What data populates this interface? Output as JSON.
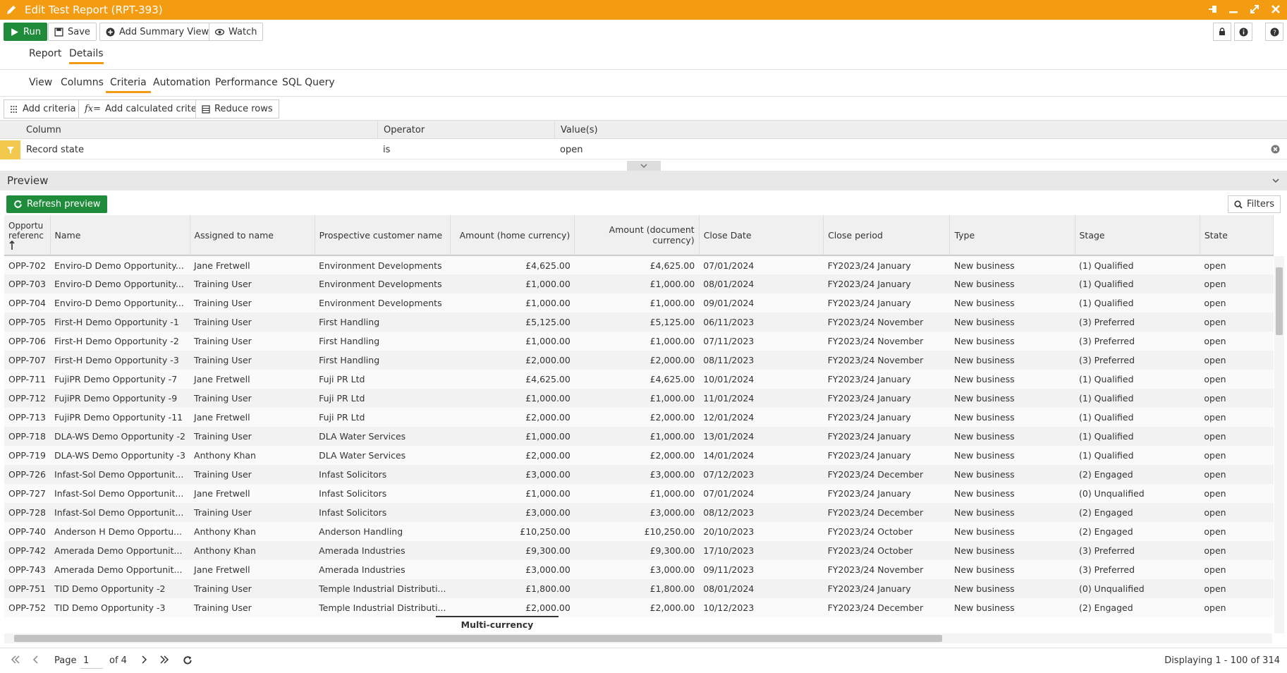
{
  "window": {
    "title": "Edit Test Report (RPT-393)",
    "accent": "#f39c12"
  },
  "toolbar": {
    "run_label": "Run",
    "save_label": "Save",
    "add_summary_label": "Add Summary View",
    "watch_label": "Watch"
  },
  "tabs_main": [
    "Report",
    "Details"
  ],
  "tabs_sub": [
    "View",
    "Columns",
    "Criteria",
    "Automation",
    "Performance",
    "SQL Query"
  ],
  "criteria_toolbar": {
    "add_criteria": "Add criteria",
    "add_calculated": "Add calculated criteria",
    "reduce_rows": "Reduce rows"
  },
  "criteria": {
    "headers": [
      "Column",
      "Operator",
      "Value(s)"
    ],
    "rows": [
      {
        "column": "Record state",
        "operator": "is",
        "value": "open"
      }
    ]
  },
  "preview": {
    "title": "Preview",
    "refresh_label": "Refresh preview",
    "filters_label": "Filters"
  },
  "grid": {
    "headers": [
      "Opportu referenc",
      "Name",
      "Assigned to name",
      "Prospective customer name",
      "Amount (home currency)",
      "Amount (document currency)",
      "Close Date",
      "Close period",
      "Type",
      "Stage",
      "State"
    ],
    "rows": [
      [
        "OPP-702",
        "Enviro-D Demo Opportunity...",
        "Jane Fretwell",
        "Environment Developments",
        "£4,625.00",
        "£4,625.00",
        "07/01/2024",
        "FY2023/24 January",
        "New business",
        "(1) Qualified",
        "open"
      ],
      [
        "OPP-703",
        "Enviro-D Demo Opportunity...",
        "Training User",
        "Environment Developments",
        "£1,000.00",
        "£1,000.00",
        "08/01/2024",
        "FY2023/24 January",
        "New business",
        "(1) Qualified",
        "open"
      ],
      [
        "OPP-704",
        "Enviro-D Demo Opportunity...",
        "Training User",
        "Environment Developments",
        "£1,000.00",
        "£1,000.00",
        "09/01/2024",
        "FY2023/24 January",
        "New business",
        "(1) Qualified",
        "open"
      ],
      [
        "OPP-705",
        "First-H Demo Opportunity -1",
        "Training User",
        "First Handling",
        "£5,125.00",
        "£5,125.00",
        "06/11/2023",
        "FY2023/24 November",
        "New business",
        "(3) Preferred",
        "open"
      ],
      [
        "OPP-706",
        "First-H Demo Opportunity -2",
        "Training User",
        "First Handling",
        "£1,000.00",
        "£1,000.00",
        "07/11/2023",
        "FY2023/24 November",
        "New business",
        "(3) Preferred",
        "open"
      ],
      [
        "OPP-707",
        "First-H Demo Opportunity -3",
        "Training User",
        "First Handling",
        "£2,000.00",
        "£2,000.00",
        "08/11/2023",
        "FY2023/24 November",
        "New business",
        "(3) Preferred",
        "open"
      ],
      [
        "OPP-711",
        "FujiPR Demo Opportunity -7",
        "Jane Fretwell",
        "Fuji PR Ltd",
        "£4,625.00",
        "£4,625.00",
        "10/01/2024",
        "FY2023/24 January",
        "New business",
        "(1) Qualified",
        "open"
      ],
      [
        "OPP-712",
        "FujiPR Demo Opportunity -9",
        "Training User",
        "Fuji PR Ltd",
        "£1,000.00",
        "£1,000.00",
        "11/01/2024",
        "FY2023/24 January",
        "New business",
        "(1) Qualified",
        "open"
      ],
      [
        "OPP-713",
        "FujiPR Demo Opportunity -11",
        "Jane Fretwell",
        "Fuji PR Ltd",
        "£2,000.00",
        "£2,000.00",
        "12/01/2024",
        "FY2023/24 January",
        "New business",
        "(1) Qualified",
        "open"
      ],
      [
        "OPP-718",
        "DLA-WS Demo Opportunity -2",
        "Training User",
        "DLA Water Services",
        "£1,000.00",
        "£1,000.00",
        "13/01/2024",
        "FY2023/24 January",
        "New business",
        "(1) Qualified",
        "open"
      ],
      [
        "OPP-719",
        "DLA-WS Demo Opportunity -3",
        "Anthony Khan",
        "DLA Water Services",
        "£2,000.00",
        "£2,000.00",
        "14/01/2024",
        "FY2023/24 January",
        "New business",
        "(1) Qualified",
        "open"
      ],
      [
        "OPP-726",
        "Infast-Sol Demo Opportunit...",
        "Training User",
        "Infast Solicitors",
        "£3,000.00",
        "£3,000.00",
        "07/12/2023",
        "FY2023/24 December",
        "New business",
        "(2) Engaged",
        "open"
      ],
      [
        "OPP-727",
        "Infast-Sol Demo Opportunit...",
        "Jane Fretwell",
        "Infast Solicitors",
        "£1,000.00",
        "£1,000.00",
        "07/01/2024",
        "FY2023/24 January",
        "New business",
        "(0) Unqualified",
        "open"
      ],
      [
        "OPP-728",
        "Infast-Sol Demo Opportunit...",
        "Training User",
        "Infast Solicitors",
        "£3,000.00",
        "£3,000.00",
        "08/12/2023",
        "FY2023/24 December",
        "New business",
        "(2) Engaged",
        "open"
      ],
      [
        "OPP-740",
        "Anderson H Demo Opportu...",
        "Anthony Khan",
        "Anderson Handling",
        "£10,250.00",
        "£10,250.00",
        "20/10/2023",
        "FY2023/24 October",
        "New business",
        "(2) Engaged",
        "open"
      ],
      [
        "OPP-742",
        "Amerada Demo Opportunit...",
        "Anthony Khan",
        "Amerada Industries",
        "£9,300.00",
        "£9,300.00",
        "17/10/2023",
        "FY2023/24 October",
        "New business",
        "(3) Preferred",
        "open"
      ],
      [
        "OPP-743",
        "Amerada Demo Opportunit...",
        "Jane Fretwell",
        "Amerada Industries",
        "£3,000.00",
        "£3,000.00",
        "09/11/2023",
        "FY2023/24 November",
        "New business",
        "(3) Preferred",
        "open"
      ],
      [
        "OPP-751",
        "TID Demo Opportunity -2",
        "Training User",
        "Temple Industrial Distributi...",
        "£1,800.00",
        "£1,800.00",
        "08/01/2024",
        "FY2023/24 January",
        "New business",
        "(0) Unqualified",
        "open"
      ],
      [
        "OPP-752",
        "TID Demo Opportunity -3",
        "Training User",
        "Temple Industrial Distributi...",
        "£2,000.00",
        "£2,000.00",
        "10/12/2023",
        "FY2023/24 December",
        "New business",
        "(2) Engaged",
        "open"
      ]
    ],
    "footer_label": "Multi-currency"
  },
  "pager": {
    "page_label": "Page",
    "page_value": "1",
    "of_label": "of 4",
    "displaying": "Displaying 1 - 100 of 314"
  }
}
